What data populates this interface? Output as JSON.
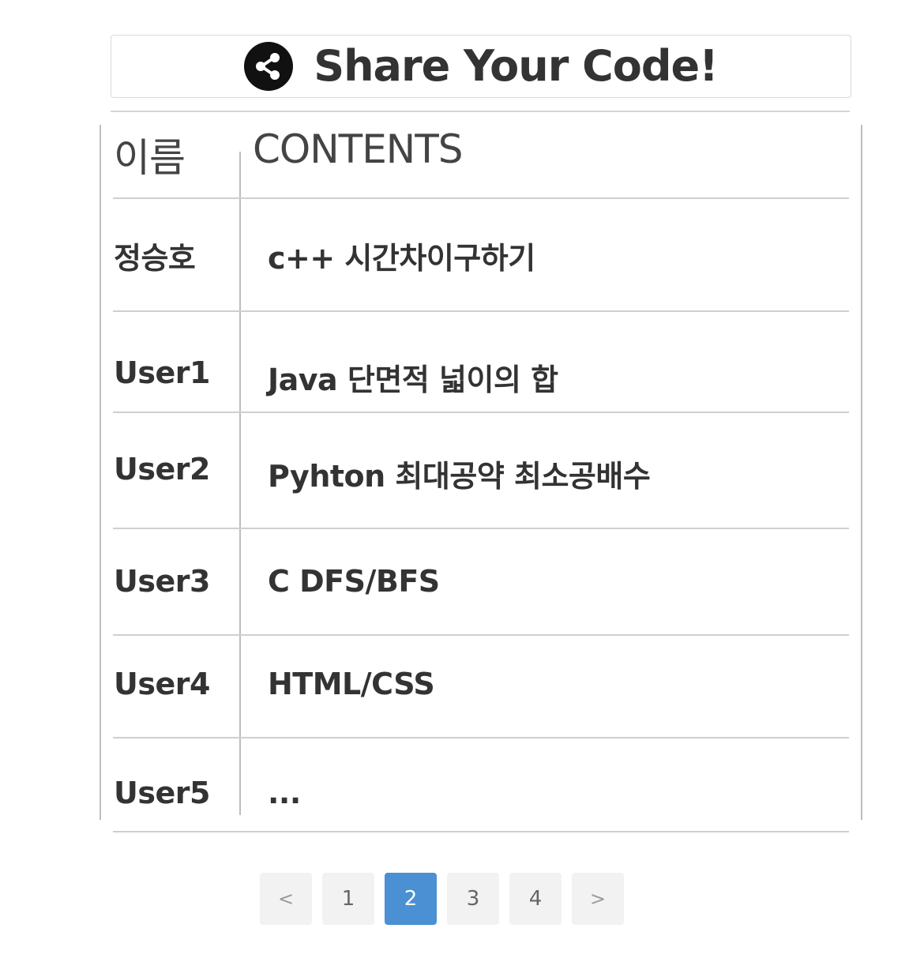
{
  "header": {
    "title": "Share Your Code!",
    "icon": "share-icon"
  },
  "table": {
    "columns": [
      "이름",
      "CONTENTS"
    ],
    "rows": [
      {
        "name": "정승호",
        "content": "c++ 시간차이구하기"
      },
      {
        "name": "User1",
        "content": "Java 단면적 넓이의 합"
      },
      {
        "name": "User2",
        "content": "Pyhton 최대공약 최소공배수"
      },
      {
        "name": "User3",
        "content": "C DFS/BFS"
      },
      {
        "name": "User4",
        "content": "HTML/CSS"
      },
      {
        "name": "User5",
        "content": "..."
      }
    ]
  },
  "pagination": {
    "prev_label": "<",
    "next_label": ">",
    "pages": [
      "1",
      "2",
      "3",
      "4"
    ],
    "current": "2"
  },
  "colors": {
    "accent": "#4a90d2",
    "text": "#333333",
    "border": "#cfcfcf",
    "button_bg": "#f2f2f2"
  }
}
